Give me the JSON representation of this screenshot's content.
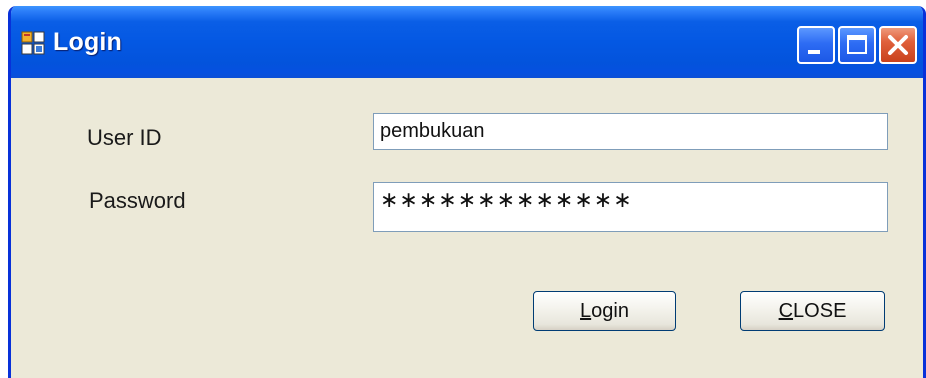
{
  "window": {
    "title": "Login",
    "icon": "form-app-icon",
    "controls": {
      "minimize": "minimize-icon",
      "maximize": "maximize-icon",
      "close": "close-icon"
    }
  },
  "form": {
    "user_id": {
      "label": "User ID",
      "value": "pembukuan"
    },
    "password": {
      "label": "Password",
      "masked_value": "∗∗∗∗∗∗∗∗∗∗∗∗∗"
    }
  },
  "buttons": {
    "login": {
      "mnemonic": "L",
      "rest": "ogin"
    },
    "close": {
      "mnemonic": "C",
      "rest": "LOSE"
    }
  },
  "colors": {
    "titlebar": "#0458e3",
    "window_bg": "#ece9d8",
    "close_button": "#e0603b",
    "field_border": "#7f9db9"
  }
}
